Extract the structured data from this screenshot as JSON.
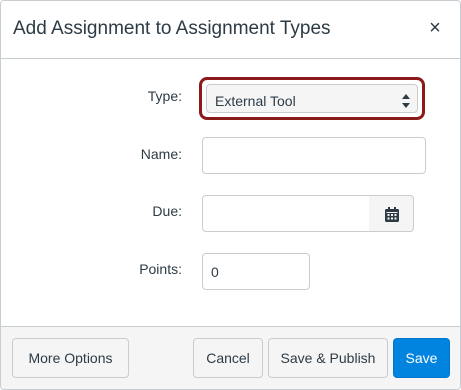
{
  "dialog": {
    "title": "Add Assignment to Assignment Types",
    "close_icon": "close-icon",
    "close_glyph": "×"
  },
  "form": {
    "type": {
      "label": "Type:",
      "value": "External Tool"
    },
    "name": {
      "label": "Name:",
      "value": ""
    },
    "due": {
      "label": "Due:",
      "value": "",
      "icon": "calendar-icon"
    },
    "points": {
      "label": "Points:",
      "value": "0"
    }
  },
  "footer": {
    "more_options_label": "More Options",
    "cancel_label": "Cancel",
    "save_publish_label": "Save & Publish",
    "save_label": "Save"
  },
  "colors": {
    "primary": "#0084e0",
    "highlight": "#8b1a1a",
    "text": "#2d3b45"
  }
}
